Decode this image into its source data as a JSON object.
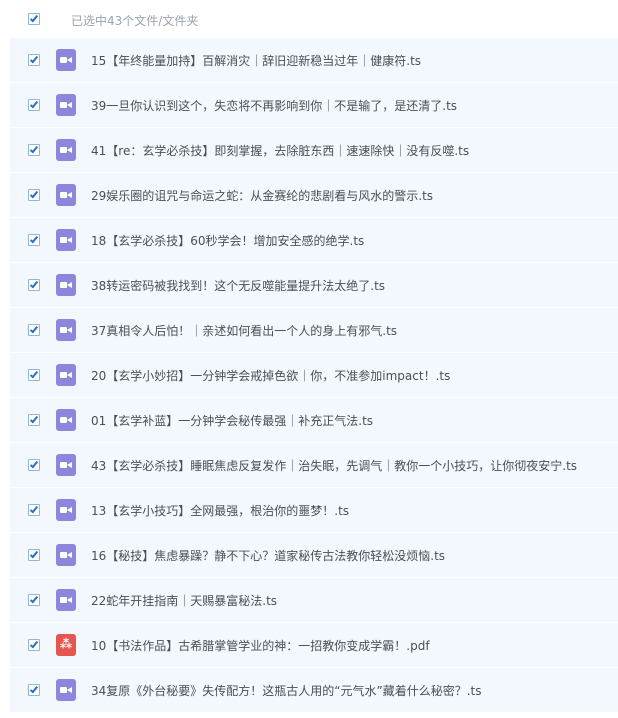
{
  "header": {
    "select_label": "已选中43个文件/文件夹",
    "checked": true
  },
  "files": [
    {
      "name": "15【年终能量加持】百解消灾｜辞旧迎新稳当过年｜健康符.ts",
      "type": "video",
      "checked": true
    },
    {
      "name": "39一旦你认识到这个，失恋将不再影响到你｜不是输了，是还清了.ts",
      "type": "video",
      "checked": true
    },
    {
      "name": "41【re：玄学必杀技】即刻掌握，去除脏东西｜速速除快｜没有反噬.ts",
      "type": "video",
      "checked": true
    },
    {
      "name": "29娱乐圈的诅咒与命运之蛇：从金赛纶的悲剧看与风水的警示.ts",
      "type": "video",
      "checked": true
    },
    {
      "name": "18【玄学必杀技】60秒学会！增加安全感的绝学.ts",
      "type": "video",
      "checked": true
    },
    {
      "name": "38转运密码被我找到！这个无反噬能量提升法太绝了.ts",
      "type": "video",
      "checked": true
    },
    {
      "name": "37真相令人后怕！｜亲述如何看出一个人的身上有邪气.ts",
      "type": "video",
      "checked": true
    },
    {
      "name": "20【玄学小妙招】一分钟学会戒掉色欲｜你，不准参加impact！.ts",
      "type": "video",
      "checked": true
    },
    {
      "name": "01【玄学补蓝】一分钟学会秘传最强｜补充正气法.ts",
      "type": "video",
      "checked": true
    },
    {
      "name": "43【玄学必杀技】睡眠焦虑反复发作｜治失眠，先调气｜教你一个小技巧，让你彻夜安宁.ts",
      "type": "video",
      "checked": true
    },
    {
      "name": "13【玄学小技巧】全网最强，根治你的噩梦！.ts",
      "type": "video",
      "checked": true
    },
    {
      "name": "16【秘技】焦虑暴躁？静不下心？道家秘传古法教你轻松没烦恼.ts",
      "type": "video",
      "checked": true
    },
    {
      "name": "22蛇年开挂指南｜天赐暴富秘法.ts",
      "type": "video",
      "checked": true
    },
    {
      "name": "10【书法作品】古希腊掌管学业的神：一招教你变成学霸！.pdf",
      "type": "pdf",
      "checked": true
    },
    {
      "name": "34复原《外台秘要》失传配方！这瓶古人用的“元气水”藏着什么秘密？.ts",
      "type": "video",
      "checked": true
    }
  ],
  "icons": {
    "checkbox": "checkbox-checked-icon",
    "video": "video-file-icon",
    "pdf": "pdf-file-icon"
  },
  "colors": {
    "row_bg": "#f2f8fd",
    "video_icon": "#8e86dc",
    "pdf_icon": "#e5564f",
    "check": "#2b6fc2",
    "text": "#4a4f57",
    "header_text": "#9aa3ad"
  }
}
